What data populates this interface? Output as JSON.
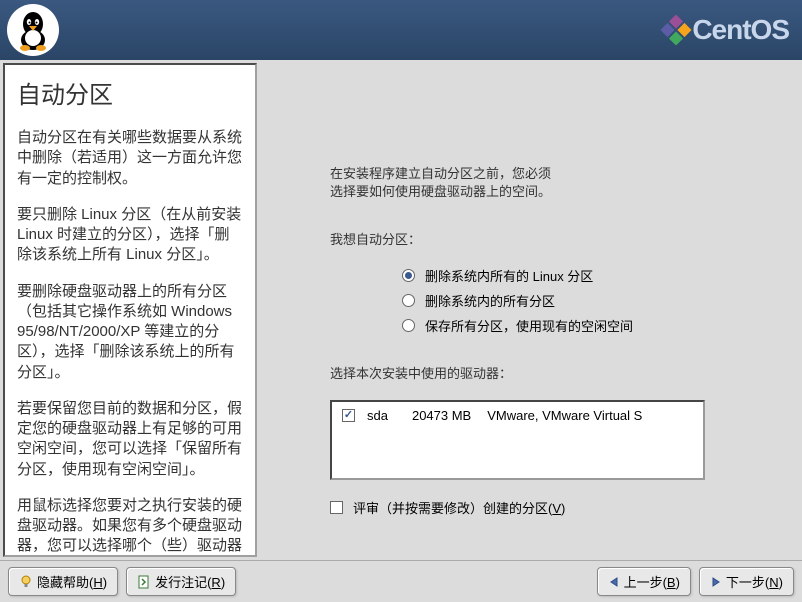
{
  "brand": "CentOS",
  "help": {
    "title": "自动分区",
    "paragraphs": [
      "自动分区在有关哪些数据要从系统中删除（若适用）这一方面允许您有一定的控制权。",
      "要只删除 Linux 分区（在从前安装 Linux 时建立的分区），选择「删除该系统上所有 Linux 分区」。",
      "要删除硬盘驱动器上的所有分区（包括其它操作系统如 Windows 95/98/NT/2000/XP 等建立的分区），选择「删除该系统上的所有分区」。",
      "若要保留您目前的数据和分区，假定您的硬盘驱动器上有足够的可用空闲空间，您可以选择「保留所有分区，使用现有空闲空间」。",
      "用鼠标选择您要对之执行安装的硬盘驱动器。如果您有多个硬盘驱动器，您可以选择哪个（些）驱动器应该包含本次安装。没被"
    ]
  },
  "main": {
    "intro1": "在安装程序建立自动分区之前，您必须",
    "intro2": "选择要如何使用硬盘驱动器上的空间。",
    "want_label": "我想自动分区：",
    "options": [
      {
        "label": "删除系统内所有的 Linux 分区",
        "checked": true
      },
      {
        "label": "删除系统内的所有分区",
        "checked": false
      },
      {
        "label": "保存所有分区，使用现有的空闲空间",
        "checked": false
      }
    ],
    "select_drives_label": "选择本次安装中使用的驱动器：",
    "drives": [
      {
        "checked": true,
        "name": "sda",
        "size": "20473 MB",
        "desc": "VMware, VMware Virtual S"
      }
    ],
    "review": {
      "checked": false,
      "prefix": "评审（并按需要修改）创建的分区(",
      "key": "V",
      "suffix": ")"
    }
  },
  "footer": {
    "hide_help": {
      "prefix": "隐藏帮助(",
      "key": "H",
      "suffix": ")"
    },
    "release_notes": {
      "prefix": "发行注记(",
      "key": "R",
      "suffix": ")"
    },
    "back": {
      "prefix": "上一步(",
      "key": "B",
      "suffix": ")"
    },
    "next": {
      "prefix": "下一步(",
      "key": "N",
      "suffix": ")"
    }
  }
}
